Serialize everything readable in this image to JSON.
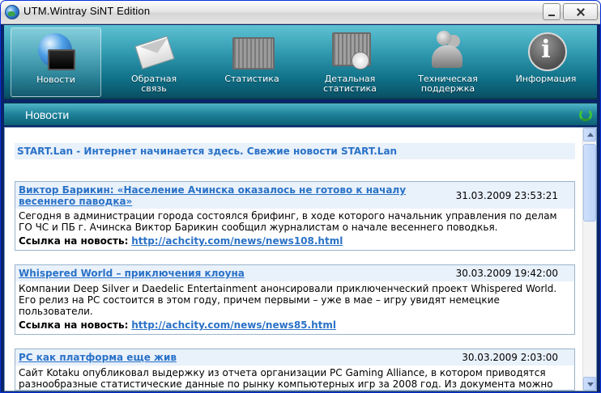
{
  "window": {
    "title": "UTM.Wintray SiNT Edition"
  },
  "toolbar": {
    "items": [
      {
        "label": "Новости",
        "icon": "globe-computer-icon",
        "active": true
      },
      {
        "label": "Обратная\nсвязь",
        "icon": "envelope-icon",
        "active": false
      },
      {
        "label": "Статистика",
        "icon": "statistics-icon",
        "active": false
      },
      {
        "label": "Детальная\nстатистика",
        "icon": "detailed-statistics-icon",
        "active": false
      },
      {
        "label": "Техническая\nподдержка",
        "icon": "support-icon",
        "active": false
      },
      {
        "label": "Информация",
        "icon": "info-icon",
        "active": false
      }
    ]
  },
  "section": {
    "title": "Новости"
  },
  "feed": {
    "title": "START.Lan - Интернет начинается здесь. Свежие новости START.Lan",
    "link_label": "Ссылка на новость:",
    "items": [
      {
        "title": "Виктор Барикин: «Население Ачинска оказалось не готово к началу весеннего паводка»",
        "date": "31.03.2009 23:53:21",
        "body": "Сегодня в администрации города состоялся брифинг, в ходе которого начальник управления по делам ГО ЧС и ПБ г. Ачинска Виктор Барикин сообщил журналистам о начале весеннего поводкья.",
        "link": "http://achcity.com/news/news108.html"
      },
      {
        "title": "Whispered World – приключения клоуна",
        "date": "30.03.2009 19:42:00",
        "body": "Компании Deep Silver и Daedelic Entertainment анонсировали приключенческий проект Whispered World. Его релиз на PC состоится в этом году, причем первыми – уже в мае – игру увидят немецкие пользователи.",
        "link": "http://achcity.com/news/news85.html"
      },
      {
        "title": "PC как платформа еще жив",
        "date": "30.03.2009 2:03:00",
        "body": "Сайт Kotaku опубликовал выдержку из отчета организации PC Gaming Alliance, в котором приводятся разнообразные статистические данные по рынку компьютерных игр за 2008 год. Из документа можно"
      }
    ]
  }
}
